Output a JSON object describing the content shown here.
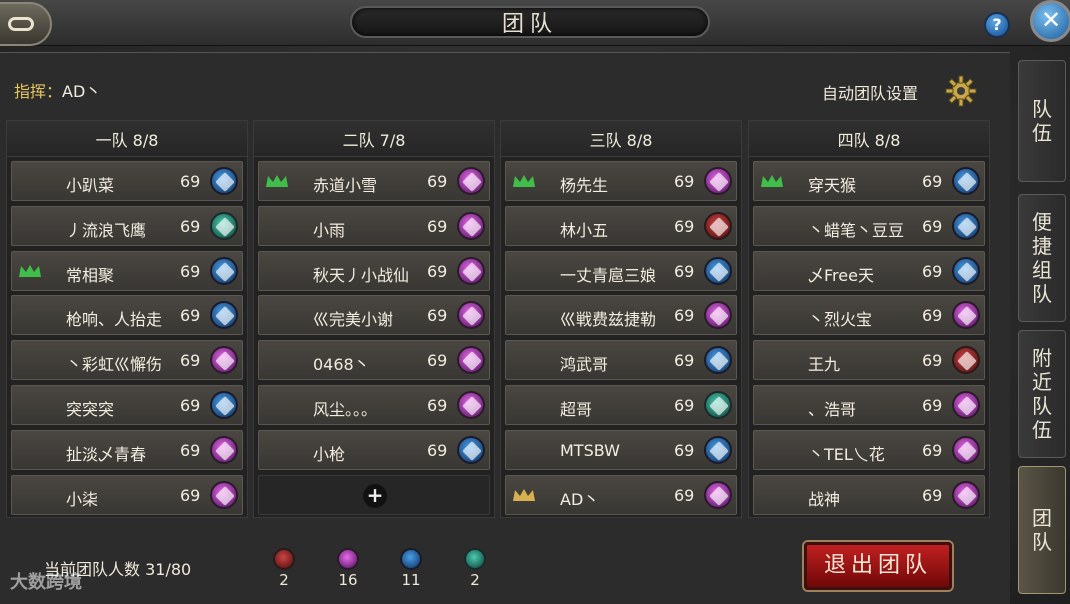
{
  "title": "团队",
  "help_label": "?",
  "close_label": "✕",
  "commander": {
    "label": "指挥：",
    "value": "AD丶"
  },
  "auto_settings_label": "自动团队设置",
  "squads": [
    {
      "header": "一队 8/8",
      "members": [
        {
          "name": "小趴菜",
          "level": "69",
          "class": "gunner",
          "leader": false
        },
        {
          "name": "丿流浪飞鹰",
          "level": "69",
          "class": "priest",
          "leader": false
        },
        {
          "name": "常相聚",
          "level": "69",
          "class": "gunner",
          "leader": true
        },
        {
          "name": "枪响、人抬走",
          "level": "69",
          "class": "gunner",
          "leader": false
        },
        {
          "name": "丶彩虹巛懈伤",
          "level": "69",
          "class": "mage",
          "leader": false
        },
        {
          "name": "突突突",
          "level": "69",
          "class": "gunner",
          "leader": false
        },
        {
          "name": "扯淡乄青春",
          "level": "69",
          "class": "mage",
          "leader": false
        },
        {
          "name": "小柒",
          "level": "69",
          "class": "mage",
          "leader": false
        }
      ]
    },
    {
      "header": "二队 7/8",
      "members": [
        {
          "name": "赤道小雪",
          "level": "69",
          "class": "mage",
          "leader": true
        },
        {
          "name": "小雨",
          "level": "69",
          "class": "mage",
          "leader": false
        },
        {
          "name": "秋天丿小战仙",
          "level": "69",
          "class": "mage",
          "leader": false
        },
        {
          "name": "巛完美小谢",
          "level": "69",
          "class": "mage",
          "leader": false
        },
        {
          "name": "0468丶",
          "level": "69",
          "class": "mage",
          "leader": false
        },
        {
          "name": "风尘。。。",
          "level": "69",
          "class": "mage",
          "leader": false
        },
        {
          "name": "小枪",
          "level": "69",
          "class": "gunner",
          "leader": false
        }
      ],
      "empty_label": "+"
    },
    {
      "header": "三队 8/8",
      "members": [
        {
          "name": "杨先生",
          "level": "69",
          "class": "mage",
          "leader": true
        },
        {
          "name": "林小五",
          "level": "69",
          "class": "warrior",
          "leader": false
        },
        {
          "name": "一丈青扈三娘",
          "level": "69",
          "class": "gunner",
          "leader": false
        },
        {
          "name": "巛戦费兹捷勒",
          "level": "69",
          "class": "mage",
          "leader": false
        },
        {
          "name": "鸿武哥",
          "level": "69",
          "class": "gunner",
          "leader": false
        },
        {
          "name": "超哥",
          "level": "69",
          "class": "priest",
          "leader": false
        },
        {
          "name": "MTSBW",
          "level": "69",
          "class": "gunner",
          "leader": false
        },
        {
          "name": "AD丶",
          "level": "69",
          "class": "mage",
          "leader": false,
          "commander": true
        }
      ]
    },
    {
      "header": "四队 8/8",
      "members": [
        {
          "name": "穿天猴",
          "level": "69",
          "class": "gunner",
          "leader": true
        },
        {
          "name": "丶蜡笔丶豆豆",
          "level": "69",
          "class": "gunner",
          "leader": false
        },
        {
          "name": "乄Free天",
          "level": "69",
          "class": "gunner",
          "leader": false
        },
        {
          "name": "丶烈火宝",
          "level": "69",
          "class": "mage",
          "leader": false
        },
        {
          "name": "王九",
          "level": "69",
          "class": "warrior",
          "leader": false
        },
        {
          "name": "、浩哥",
          "level": "69",
          "class": "mage",
          "leader": false
        },
        {
          "name": "丶TEL乀花",
          "level": "69",
          "class": "mage",
          "leader": false
        },
        {
          "name": "战神",
          "level": "69",
          "class": "mage",
          "leader": false
        }
      ]
    }
  ],
  "team_count_label": "当前团队人数 31/80",
  "class_summary": [
    {
      "class": "warrior",
      "count": "2"
    },
    {
      "class": "mage",
      "count": "16"
    },
    {
      "class": "gunner",
      "count": "11"
    },
    {
      "class": "priest",
      "count": "2"
    }
  ],
  "exit_button": "退出团队",
  "side_tabs": [
    {
      "label": "队伍",
      "active": false
    },
    {
      "label": "便捷组队",
      "active": false
    },
    {
      "label": "附近队伍",
      "active": false
    },
    {
      "label": "团队",
      "active": true
    }
  ],
  "watermark": "大数跨境",
  "colors": {
    "leader_green": "#3fbf4a",
    "commander_gold": "#d8b050",
    "commander_label": "#e6c560",
    "exit_red": "#c02020"
  }
}
